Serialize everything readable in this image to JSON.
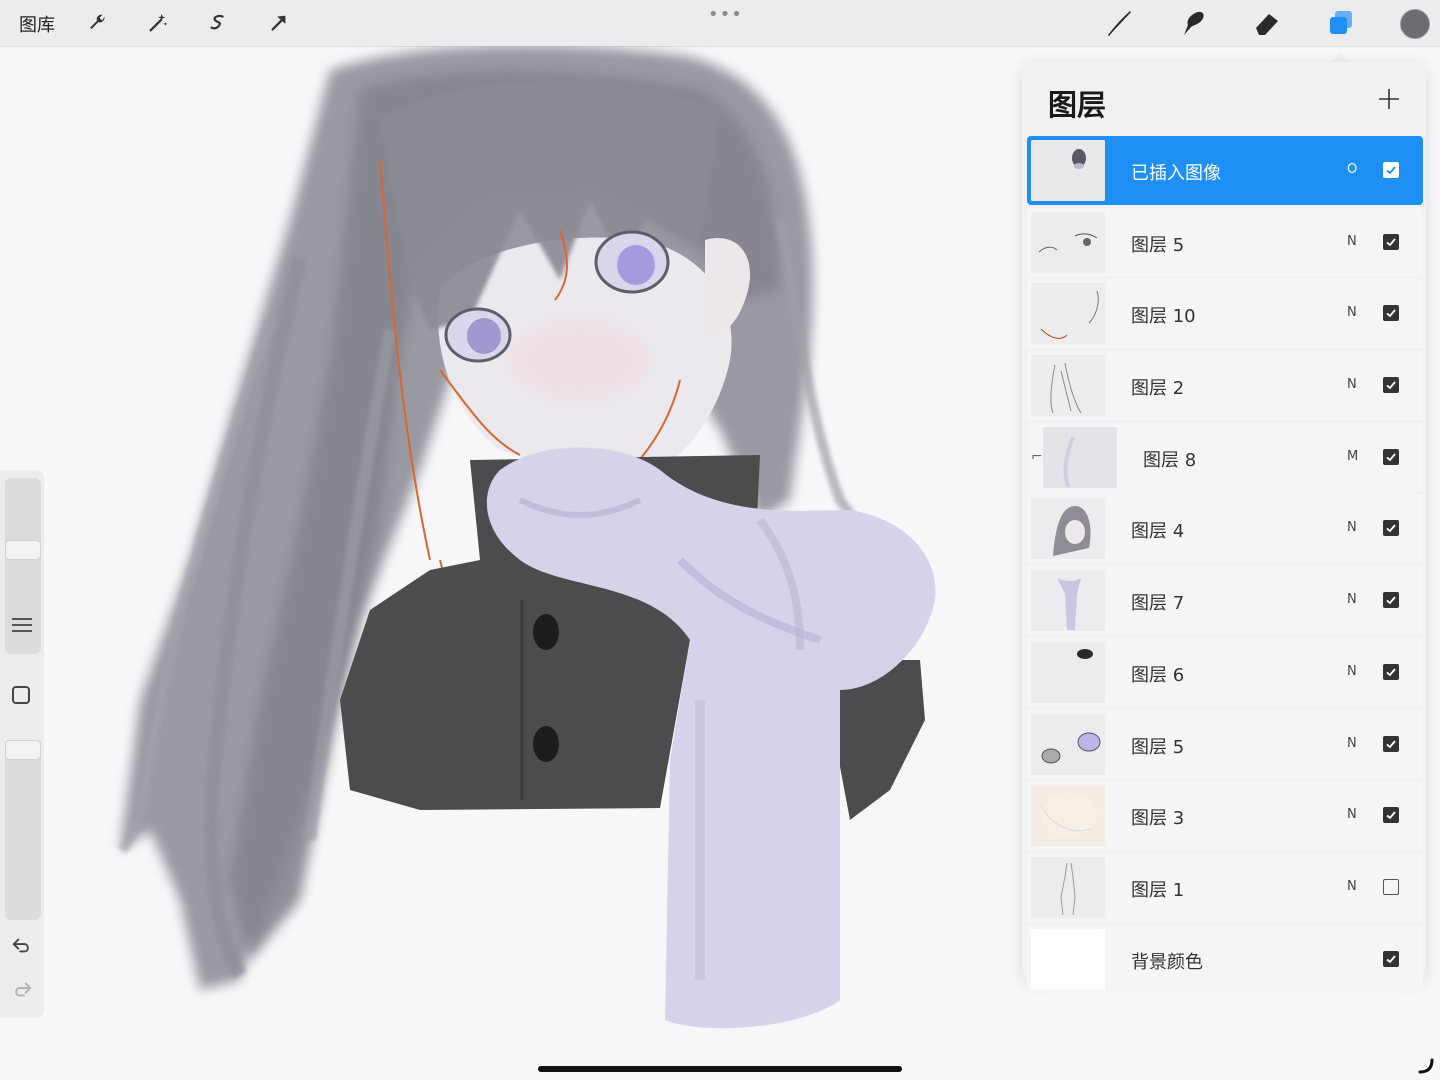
{
  "toolbar": {
    "gallery_label": "图库",
    "left_tools": [
      "wrench-icon",
      "magic-wand-icon",
      "selection-icon",
      "transform-arrow-icon"
    ],
    "right_tools": [
      "brush-icon",
      "smudge-icon",
      "eraser-icon",
      "layers-icon"
    ],
    "more": "•••",
    "active_color": "#6d6c72"
  },
  "layers_panel": {
    "title": "图层",
    "add": "+",
    "layers": [
      {
        "name": "已插入图像",
        "blend": "O",
        "visible": true,
        "selected": true,
        "clipped": false
      },
      {
        "name": "图层 5",
        "blend": "N",
        "visible": true,
        "selected": false,
        "clipped": false
      },
      {
        "name": "图层 10",
        "blend": "N",
        "visible": true,
        "selected": false,
        "clipped": false
      },
      {
        "name": "图层 2",
        "blend": "N",
        "visible": true,
        "selected": false,
        "clipped": false
      },
      {
        "name": "图层 8",
        "blend": "M",
        "visible": true,
        "selected": false,
        "clipped": true
      },
      {
        "name": "图层 4",
        "blend": "N",
        "visible": true,
        "selected": false,
        "clipped": false
      },
      {
        "name": "图层 7",
        "blend": "N",
        "visible": true,
        "selected": false,
        "clipped": false
      },
      {
        "name": "图层 6",
        "blend": "N",
        "visible": true,
        "selected": false,
        "clipped": false
      },
      {
        "name": "图层 5",
        "blend": "N",
        "visible": true,
        "selected": false,
        "clipped": false
      },
      {
        "name": "图层 3",
        "blend": "N",
        "visible": true,
        "selected": false,
        "clipped": false
      },
      {
        "name": "图层 1",
        "blend": "N",
        "visible": false,
        "selected": false,
        "clipped": false
      },
      {
        "name": "背景颜色",
        "blend": "",
        "visible": true,
        "selected": false,
        "clipped": false
      }
    ]
  },
  "colors": {
    "accent": "#1e8ff5",
    "hair": "#8d8c94",
    "scarf": "#d6d4ea",
    "coat": "#4a4a4c"
  }
}
